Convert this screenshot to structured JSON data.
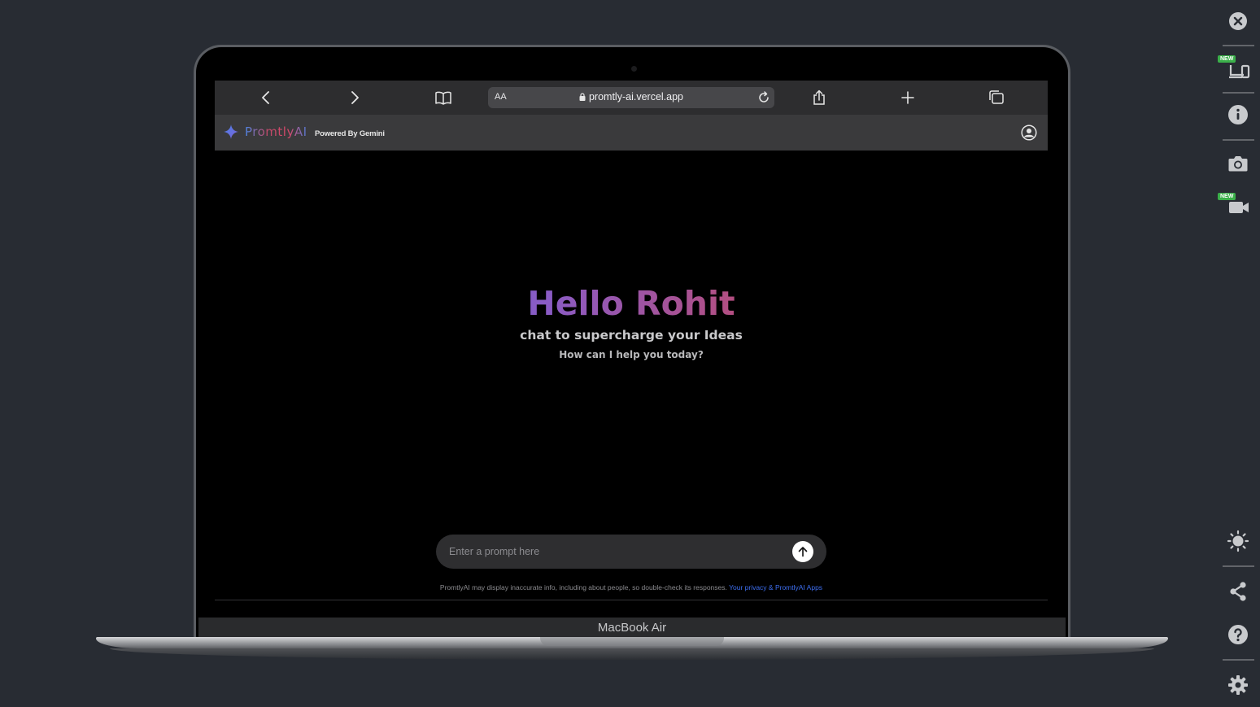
{
  "browser": {
    "url": "promtly-ai.vercel.app",
    "text_size_label": "AA"
  },
  "app": {
    "brand": "PromtlyAI",
    "powered_by": "Powered By Gemini"
  },
  "greeting": {
    "title": "Hello Rohit",
    "subtitle": "chat to supercharge your Ideas",
    "prompt_question": "How can I help you today?"
  },
  "prompt": {
    "placeholder": "Enter a prompt here"
  },
  "footer": {
    "disclaimer": "PromtlyAI may display inaccurate info, including about people, so double-check its responses.",
    "link": "Your privacy & PromtlyAI Apps"
  },
  "device": {
    "label": "MacBook Air"
  },
  "sidebar": {
    "new_badge": "NEW"
  },
  "colors": {
    "background": "#282c33",
    "brand_gradient_start": "#4f6fd6",
    "brand_gradient_end": "#d04a60",
    "link": "#3d6ef0",
    "badge": "#3bb04a"
  }
}
